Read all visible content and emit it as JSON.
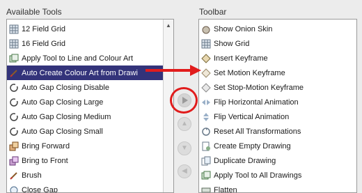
{
  "available": {
    "title": "Available Tools",
    "items": [
      {
        "label": "12 Field Grid",
        "icon": "grid-icon"
      },
      {
        "label": "16 Field Grid",
        "icon": "grid-icon"
      },
      {
        "label": "Apply Tool to Line and Colour Art",
        "icon": "layers-icon"
      },
      {
        "label": "Auto Create Colour Art from Drawi",
        "icon": "brush-icon",
        "selected": true
      },
      {
        "label": "Auto Gap Closing Disable",
        "icon": "gap-closing-icon"
      },
      {
        "label": "Auto Gap Closing Large",
        "icon": "gap-closing-icon"
      },
      {
        "label": "Auto Gap Closing Medium",
        "icon": "gap-closing-icon"
      },
      {
        "label": "Auto Gap Closing Small",
        "icon": "gap-closing-icon"
      },
      {
        "label": "Bring Forward",
        "icon": "bring-forward-icon"
      },
      {
        "label": "Bring to Front",
        "icon": "bring-front-icon"
      },
      {
        "label": "Brush",
        "icon": "brush-icon"
      },
      {
        "label": "Close Gap",
        "icon": "close-gap-icon"
      }
    ]
  },
  "toolbar": {
    "title": "Toolbar",
    "items": [
      {
        "label": "Show Onion Skin",
        "icon": "onion-skin-icon"
      },
      {
        "label": "Show Grid",
        "icon": "grid-icon"
      },
      {
        "label": "Insert Keyframe",
        "icon": "keyframe-icon"
      },
      {
        "label": "Set Motion Keyframe",
        "icon": "motion-keyframe-icon"
      },
      {
        "label": "Set Stop-Motion Keyframe",
        "icon": "stop-motion-keyframe-icon"
      },
      {
        "label": "Flip Horizontal Animation",
        "icon": "flip-horizontal-icon"
      },
      {
        "label": "Flip Vertical Animation",
        "icon": "flip-vertical-icon"
      },
      {
        "label": "Reset All Transformations",
        "icon": "reset-icon"
      },
      {
        "label": "Create Empty Drawing",
        "icon": "new-drawing-icon"
      },
      {
        "label": "Duplicate Drawing",
        "icon": "duplicate-icon"
      },
      {
        "label": "Apply Tool to All Drawings",
        "icon": "layers-icon"
      },
      {
        "label": "Flatten",
        "icon": "flatten-icon"
      }
    ]
  },
  "buttons": {
    "add_icon": "play-arrow-icon",
    "up_icon": "arrow-up-icon",
    "down_icon": "arrow-down-icon",
    "remove_icon": "arrow-left-icon"
  },
  "annotation": {
    "color": "#e11c1c"
  },
  "colors": {
    "selection": "#33337a"
  }
}
